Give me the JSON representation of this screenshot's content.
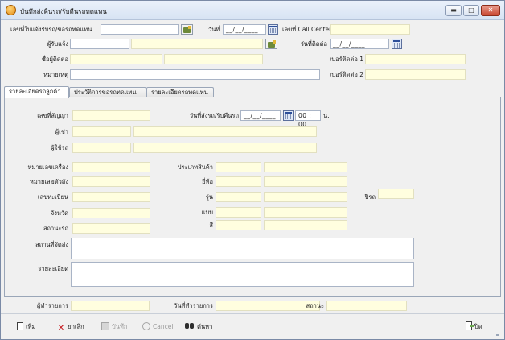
{
  "window": {
    "title": "บันทึกส่งคืนรถ/รับคืนรถทดแทน",
    "minimize": "▬",
    "maximize": "□",
    "close": "✕"
  },
  "header": {
    "doc_no_label": "เลขที่ใบแจ้งรับรถ/ขอรถทดแทน",
    "date_label": "วันที่",
    "date_value": "__/__/____",
    "callcenter_label": "เลขที่ Call Center",
    "notifier_label": "ผู้รับแจ้ง",
    "contact_date_label": "วันที่ติดต่อ",
    "contact_date_value": "__/__/____",
    "contact_name_label": "ชื่อผู้ติดต่อ",
    "phone1_label": "เบอร์ติดต่อ 1",
    "note_label": "หมายเหตุ",
    "phone2_label": "เบอร์ติดต่อ 2"
  },
  "tabs": [
    {
      "label": "รายละเอียดรถลูกค้า"
    },
    {
      "label": "ประวัติการขอรถทดแทน"
    },
    {
      "label": "รายละเอียดรถทดแทน"
    }
  ],
  "details": {
    "contract_label": "เลขที่สัญญา",
    "send_date_label": "วันที่ส่งรถ/รับคืนรถ",
    "send_date_value": "__/__/____",
    "time_value": "00 : 00",
    "time_unit": "น.",
    "renter_label": "ผู้เช่า",
    "user_label": "ผู้ใช้รถ",
    "engine_label": "หมายเลขเครื่อง",
    "chassis_label": "หมายเลขตัวถัง",
    "plate_label": "เลขทะเบียน",
    "province_label": "จังหวัด",
    "status_label": "สถานะรถ",
    "product_type_label": "ประเภทสินค้า",
    "brand_label": "ยี่ห้อ",
    "model_label": "รุ่น",
    "style_label": "แบบ",
    "color_label": "สี",
    "year_label": "ปีรถ",
    "location_label": "สถานที่จัดส่ง",
    "detail_label": "รายละเอียด"
  },
  "footer": {
    "reporter_label": "ผู้ทำรายการ",
    "report_date_label": "วันที่ทำรายการ",
    "status_label": "สถานะ"
  },
  "toolbar": {
    "add": "เพิ่ม",
    "cancel_doc": "ยกเลิก",
    "save": "บันทึก",
    "cancel": "Cancel",
    "search": "ค้นหา",
    "close": "ปิด"
  }
}
